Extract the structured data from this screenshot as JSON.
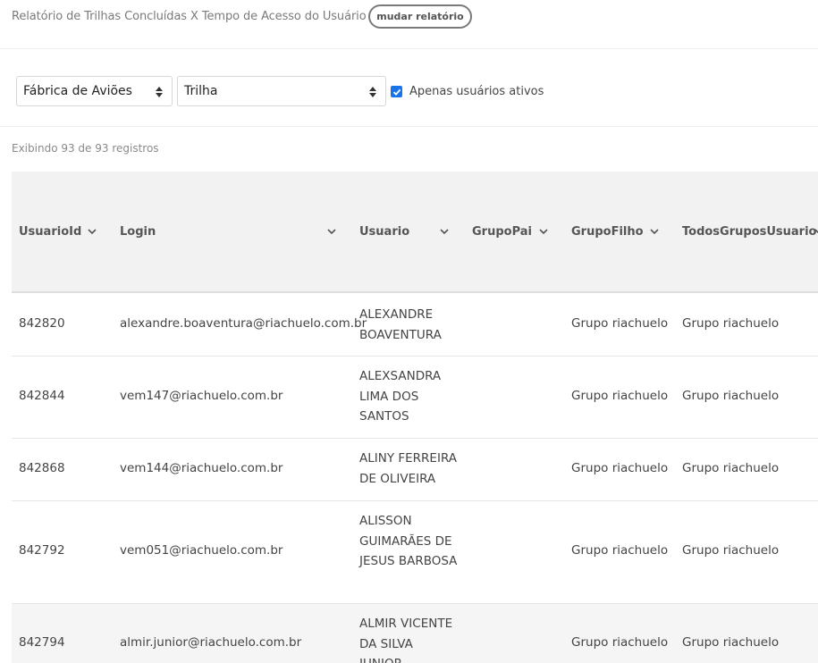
{
  "header": {
    "title": "Relatório de Trilhas Concluídas X Tempo de Acesso do Usuário",
    "change_button": "mudar relatório"
  },
  "filters": {
    "fabrica_value": "Fábrica de Aviões",
    "trilha_value": "Trilha",
    "active_only_label": "Apenas usuários ativos",
    "active_only_checked": true
  },
  "records_text": "Exibindo 93 de 93 registros",
  "table": {
    "columns": [
      "UsuarioId",
      "Login",
      "Usuario",
      "GrupoPai",
      "GrupoFilho",
      "TodosGruposUsuario"
    ],
    "rows": [
      {
        "id": "842820",
        "login": "alexandre.boaventura@riachuelo.com.br",
        "usuario": "ALEXANDRE BOAVENTURA",
        "grupo_pai": "",
        "grupo_filho": "Grupo riachuelo",
        "todos": "Grupo riachuelo"
      },
      {
        "id": "842844",
        "login": "vem147@riachuelo.com.br",
        "usuario": "ALEXSANDRA LIMA DOS SANTOS",
        "grupo_pai": "",
        "grupo_filho": "Grupo riachuelo",
        "todos": "Grupo riachuelo"
      },
      {
        "id": "842868",
        "login": "vem144@riachuelo.com.br",
        "usuario": "ALINY FERREIRA DE OLIVEIRA",
        "grupo_pai": "",
        "grupo_filho": "Grupo riachuelo",
        "todos": "Grupo riachuelo"
      },
      {
        "id": "842792",
        "login": "vem051@riachuelo.com.br",
        "usuario": "ALISSON GUIMARÃES DE JESUS BARBOSA",
        "grupo_pai": "",
        "grupo_filho": "Grupo riachuelo",
        "todos": "Grupo riachuelo"
      },
      {
        "id": "842794",
        "login": "almir.junior@riachuelo.com.br",
        "usuario": "ALMIR VICENTE DA SILVA JUNIOR",
        "grupo_pai": "",
        "grupo_filho": "Grupo riachuelo",
        "todos": "Grupo riachuelo"
      }
    ]
  },
  "colors": {
    "checkbox": "#1a73e8",
    "header_bg": "#f2f2f2",
    "alt_row_bg": "#f5f5f5"
  }
}
